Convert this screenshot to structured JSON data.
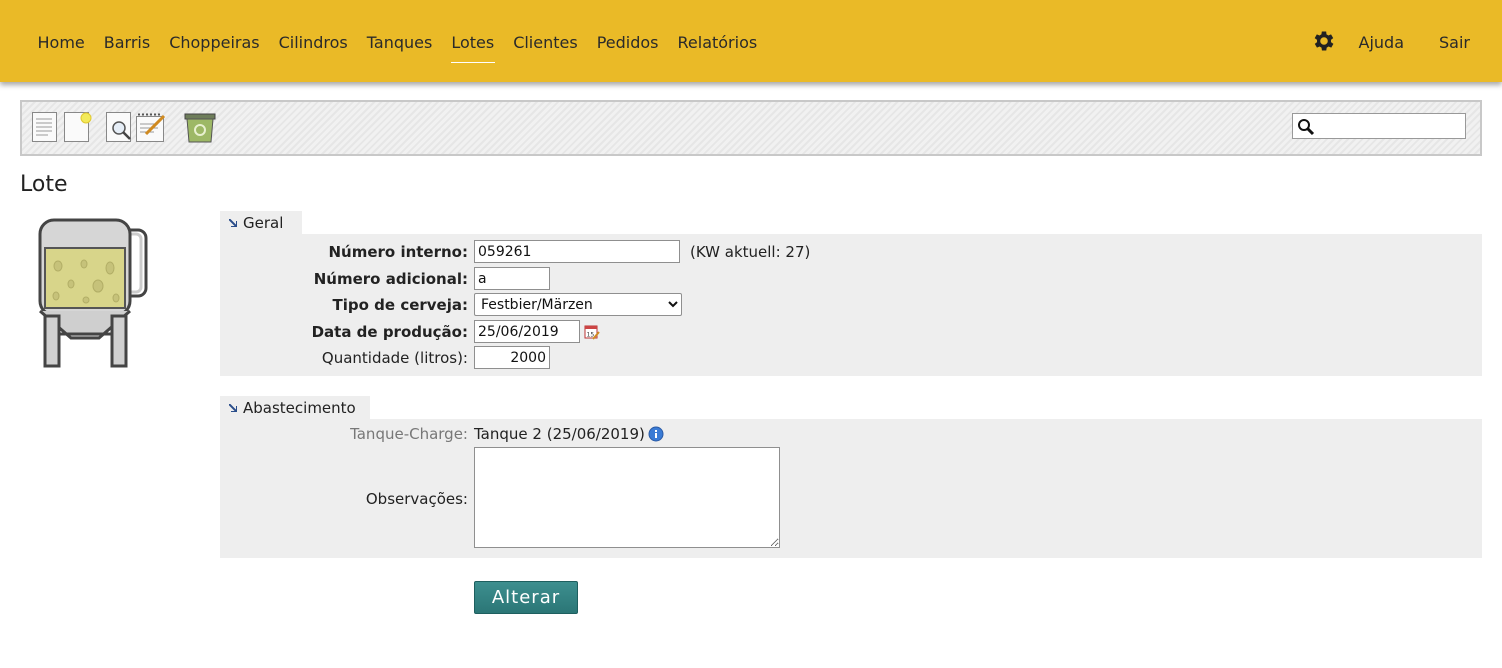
{
  "nav": {
    "items": [
      {
        "label": "Home"
      },
      {
        "label": "Barris"
      },
      {
        "label": "Choppeiras"
      },
      {
        "label": "Cilindros"
      },
      {
        "label": "Tanques"
      },
      {
        "label": "Lotes"
      },
      {
        "label": "Clientes"
      },
      {
        "label": "Pedidos"
      },
      {
        "label": "Relatórios"
      }
    ],
    "active": "Lotes",
    "help_label": "Ajuda",
    "logout_label": "Sair"
  },
  "toolbar": {
    "icons": [
      "list-icon",
      "new-document-icon",
      "search-document-icon",
      "edit-icon",
      "recycle-bin-icon"
    ],
    "search": {
      "value": "",
      "placeholder": ""
    }
  },
  "page_title": "Lote",
  "geral": {
    "legend": "Geral",
    "numero_interno": {
      "label": "Número interno:",
      "value": "059261",
      "note": "(KW aktuell: 27)"
    },
    "numero_adicional": {
      "label": "Número adicional:",
      "value": "a"
    },
    "tipo_cerveja": {
      "label": "Tipo de cerveja:",
      "selected": "Festbier/Märzen"
    },
    "data_producao": {
      "label": "Data de produção:",
      "value": "25/06/2019"
    },
    "quantidade": {
      "label": "Quantidade (litros):",
      "value": "2000"
    }
  },
  "abastecimento": {
    "legend": "Abastecimento",
    "tanque_charge": {
      "label": "Tanque-Charge:",
      "value": "Tanque 2 (25/06/2019)"
    },
    "observacoes": {
      "label": "Observações:",
      "value": ""
    }
  },
  "submit_label": "Alterar",
  "colors": {
    "topbar": "#eaba27",
    "button": "#2e7b7b",
    "section_bg": "#eeeeee"
  }
}
